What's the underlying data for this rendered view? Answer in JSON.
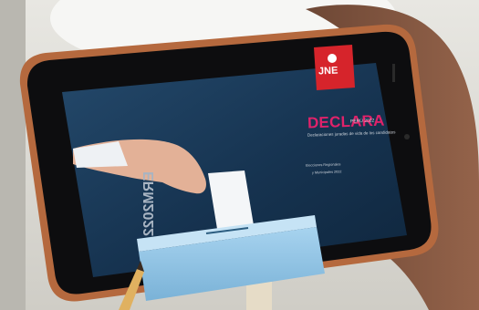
{
  "screen": {
    "logo": {
      "text": "JNE"
    },
    "headline": {
      "text": "DECLARA",
      "suffix": "PERÚ 2022"
    },
    "tagline": "Declaraciones juradas de vida de los candidatos",
    "info": {
      "line1": "Elecciones Regionales",
      "line2": "y Municipales 2022"
    },
    "vertical_mark": "ERM2022"
  },
  "colors": {
    "screen_bg": "#163350",
    "accent": "#e0226a",
    "logo_red": "#d6242b",
    "ballot_box": "#8fc3e4",
    "phone_case": "#b5693e"
  },
  "icons": [
    "jne-logo-icon"
  ]
}
